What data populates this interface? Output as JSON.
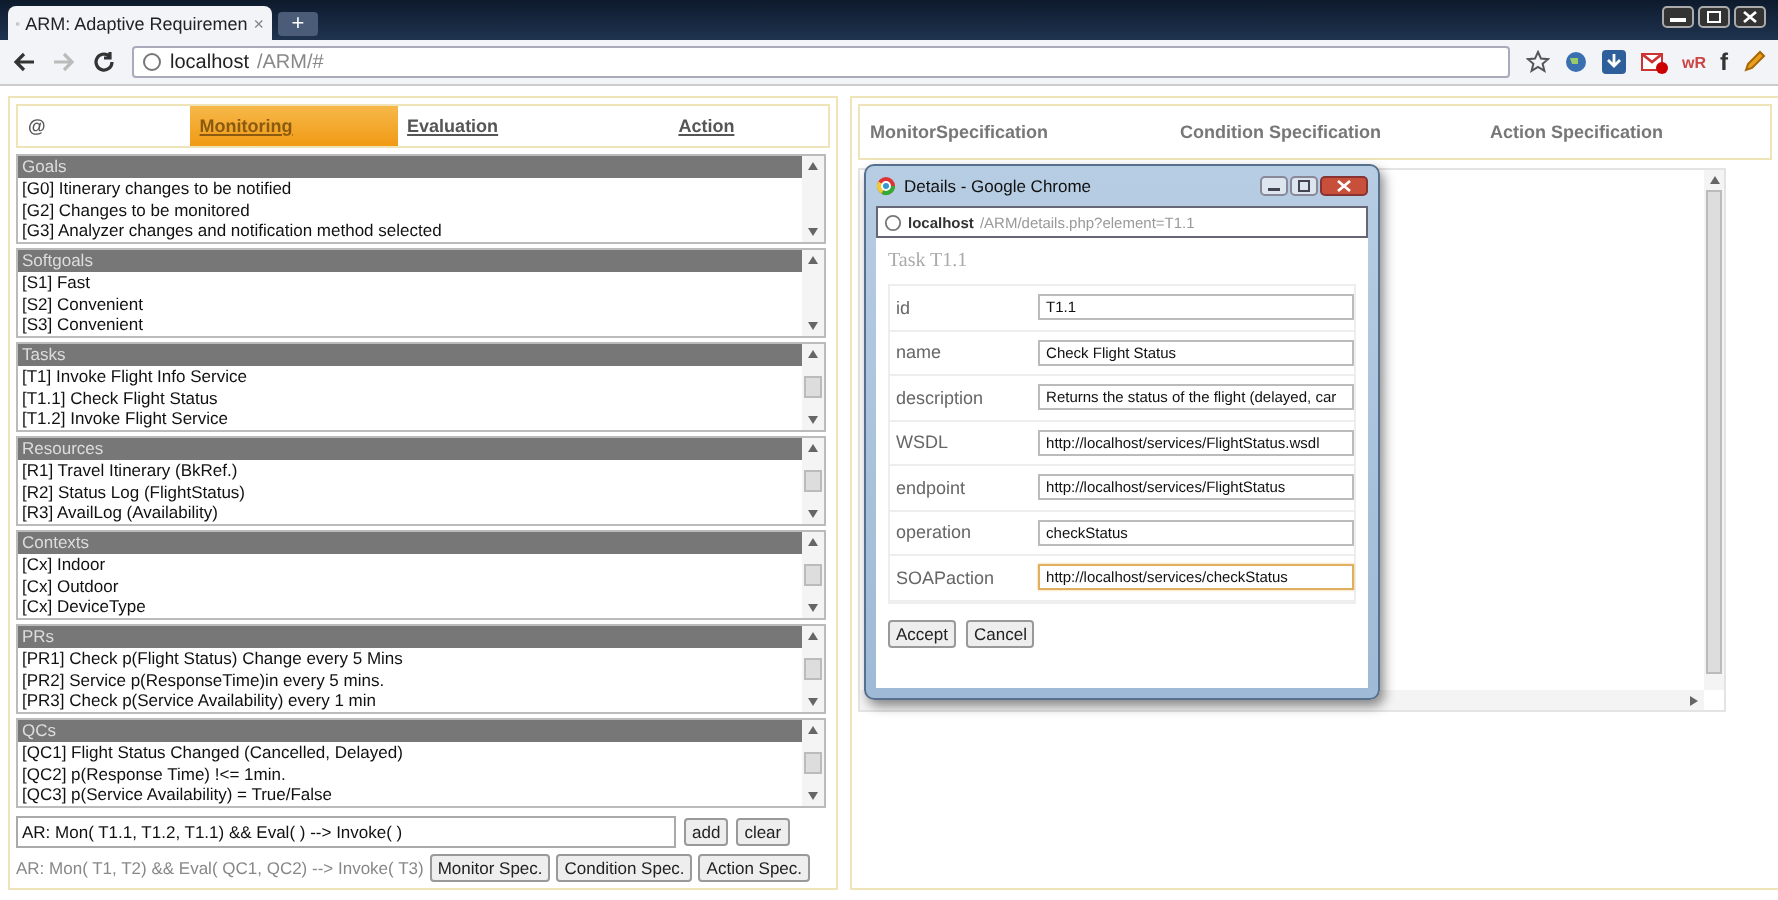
{
  "browser": {
    "tab_title": "ARM: Adaptive Requiremen",
    "tab_close": "×",
    "new_tab": "+",
    "url_host": "localhost",
    "url_path": "/ARM/#",
    "ext_labels": [
      "wR",
      "f"
    ]
  },
  "left_tabs": [
    {
      "label": "@",
      "selected": false
    },
    {
      "label": "Monitoring",
      "selected": true
    },
    {
      "label": "Evaluation",
      "selected": false
    },
    {
      "label": "Action",
      "selected": false
    }
  ],
  "sections": [
    {
      "title": "Goals",
      "items": [
        "[G0] Itinerary changes to be notified",
        "[G2] Changes to be monitored",
        "[G3] Analyzer changes and notification method selected"
      ]
    },
    {
      "title": "Softgoals",
      "items": [
        "[S1] Fast",
        "[S2] Convenient",
        "[S3] Convenient"
      ]
    },
    {
      "title": "Tasks",
      "items": [
        "[T1] Invoke Flight Info Service",
        "[T1.1] Check Flight Status",
        "[T1.2] Invoke Flight Service"
      ]
    },
    {
      "title": "Resources",
      "items": [
        "[R1] Travel Itinerary (BkRef.)",
        "[R2] Status Log (FlightStatus)",
        "[R3] AvailLog (Availability)"
      ]
    },
    {
      "title": "Contexts",
      "items": [
        "[Cx] Indoor",
        "[Cx] Outdoor",
        "[Cx] DeviceType"
      ]
    },
    {
      "title": "PRs",
      "items": [
        "[PR1] Check p(Flight Status) Change every 5 Mins",
        "[PR2] Service p(ResponseTime)in every 5 mins.",
        "[PR3] Check p(Service Availability) every 1 min"
      ]
    },
    {
      "title": "QCs",
      "items": [
        "[QC1] Flight Status Changed (Cancelled, Delayed)",
        "[QC2] p(Response Time) !<= 1min.",
        "[QC3] p(Service Availability) = True/False"
      ]
    }
  ],
  "rule_input": {
    "value": "AR: Mon( T1.1, T1.2, T1.1) && Eval( ) --> Invoke( )"
  },
  "rule_buttons": [
    "add",
    "clear"
  ],
  "rule_hint": "AR: Mon( T1, T2) && Eval( QC1, QC2) --> Invoke( T3)",
  "spec_buttons": [
    "Monitor Spec.",
    "Condition Spec.",
    "Action Spec."
  ],
  "right_headers": [
    "MonitorSpecification",
    "Condition Specification",
    "Action Specification"
  ],
  "popup": {
    "title": "Details - Google Chrome",
    "url_host": "localhost",
    "url_path": "/ARM/details.php?element=T1.1",
    "heading": "Task T1.1",
    "fields": [
      {
        "label": "id",
        "value": "T1.1",
        "focused": false
      },
      {
        "label": "name",
        "value": "Check Flight Status",
        "focused": false
      },
      {
        "label": "description",
        "value": "Returns the status of the flight (delayed, car",
        "focused": false
      },
      {
        "label": "WSDL",
        "value": "http://localhost/services/FlightStatus.wsdl",
        "focused": false
      },
      {
        "label": "endpoint",
        "value": "http://localhost/services/FlightStatus",
        "focused": false
      },
      {
        "label": "operation",
        "value": "checkStatus",
        "focused": false
      },
      {
        "label": "SOAPaction",
        "value": "http://localhost/services/checkStatus",
        "focused": true
      }
    ],
    "buttons": [
      "Accept",
      "Cancel"
    ]
  }
}
